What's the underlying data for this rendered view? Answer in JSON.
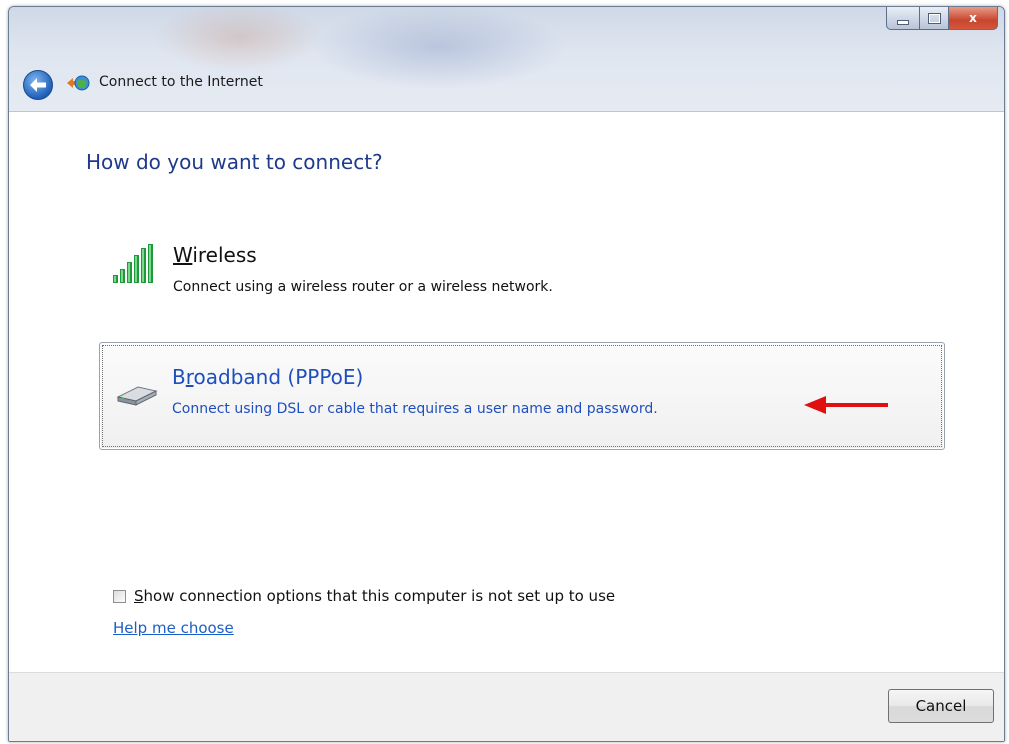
{
  "window": {
    "title": "Connect to the Internet",
    "caption_buttons": {
      "minimize": "",
      "maximize": "",
      "close": "x"
    }
  },
  "heading": "How do you want to connect?",
  "options": [
    {
      "title_prefix": "",
      "title_access_key": "W",
      "title_rest": "ireless",
      "description": "Connect using a wireless router or a wireless network.",
      "icon": "signal-bars-icon",
      "selected": false
    },
    {
      "title_prefix": "B",
      "title_access_key": "r",
      "title_rest": "oadband (PPPoE)",
      "description": "Connect using DSL or cable that requires a user name and password.",
      "icon": "broadband-modem-icon",
      "selected": true
    }
  ],
  "show_options": {
    "access_key": "S",
    "label_rest": "how connection options that this computer is not set up to use",
    "checked": false
  },
  "help_link": "Help me choose",
  "footer": {
    "cancel_label": "Cancel"
  },
  "colors": {
    "heading": "#1f3a8a",
    "link": "#1c5ec7",
    "selected_text": "#1f4fbf",
    "annotation_arrow": "#e01010"
  }
}
